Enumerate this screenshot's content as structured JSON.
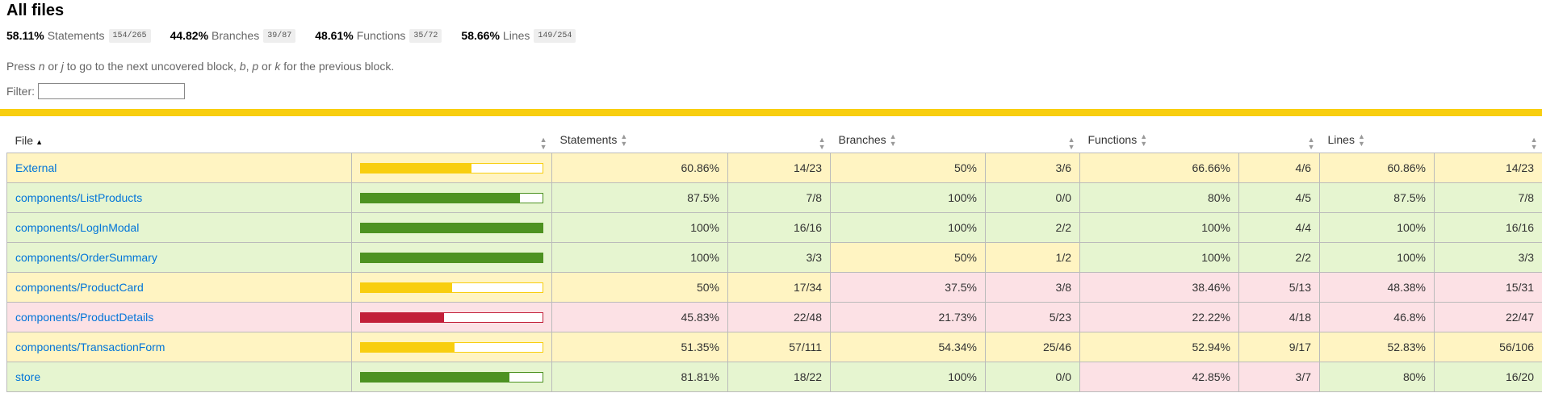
{
  "page": {
    "title": "All files"
  },
  "summary": [
    {
      "pct": "58.11%",
      "label": "Statements",
      "frac": "154/265"
    },
    {
      "pct": "44.82%",
      "label": "Branches",
      "frac": "39/87"
    },
    {
      "pct": "48.61%",
      "label": "Functions",
      "frac": "35/72"
    },
    {
      "pct": "58.66%",
      "label": "Lines",
      "frac": "149/254"
    }
  ],
  "hint": {
    "t1": "Press ",
    "k1": "n",
    "t2": " or ",
    "k2": "j",
    "t3": " to go to the next uncovered block, ",
    "k3": "b",
    "t4": ", ",
    "k4": "p",
    "t5": " or ",
    "k5": "k",
    "t6": " for the previous block."
  },
  "filter": {
    "label": "Filter:",
    "value": ""
  },
  "colors": {
    "high": "#4d9221",
    "medium": "#f8ce0f",
    "low": "#c21f39"
  },
  "table": {
    "headers": {
      "file": "File",
      "statements": "Statements",
      "branches": "Branches",
      "functions": "Functions",
      "lines": "Lines"
    },
    "rows": [
      {
        "file": "External",
        "level": "medium",
        "coverage": 60.86,
        "stmt": "60.86%",
        "stmt_frac": "14/23",
        "br": "50%",
        "br_frac": "3/6",
        "fn": "66.66%",
        "fn_frac": "4/6",
        "ln": "60.86%",
        "ln_frac": "14/23",
        "lv": [
          "medium",
          "medium",
          "medium",
          "medium"
        ]
      },
      {
        "file": "components/ListProducts",
        "level": "high",
        "coverage": 87.5,
        "stmt": "87.5%",
        "stmt_frac": "7/8",
        "br": "100%",
        "br_frac": "0/0",
        "fn": "80%",
        "fn_frac": "4/5",
        "ln": "87.5%",
        "ln_frac": "7/8",
        "lv": [
          "high",
          "high",
          "high",
          "high"
        ]
      },
      {
        "file": "components/LogInModal",
        "level": "high",
        "coverage": 100,
        "stmt": "100%",
        "stmt_frac": "16/16",
        "br": "100%",
        "br_frac": "2/2",
        "fn": "100%",
        "fn_frac": "4/4",
        "ln": "100%",
        "ln_frac": "16/16",
        "lv": [
          "high",
          "high",
          "high",
          "high"
        ]
      },
      {
        "file": "components/OrderSummary",
        "level": "high",
        "coverage": 100,
        "stmt": "100%",
        "stmt_frac": "3/3",
        "br": "50%",
        "br_frac": "1/2",
        "fn": "100%",
        "fn_frac": "2/2",
        "ln": "100%",
        "ln_frac": "3/3",
        "lv": [
          "high",
          "medium",
          "high",
          "high"
        ]
      },
      {
        "file": "components/ProductCard",
        "level": "medium",
        "coverage": 50,
        "stmt": "50%",
        "stmt_frac": "17/34",
        "br": "37.5%",
        "br_frac": "3/8",
        "fn": "38.46%",
        "fn_frac": "5/13",
        "ln": "48.38%",
        "ln_frac": "15/31",
        "lv": [
          "medium",
          "low",
          "low",
          "low"
        ]
      },
      {
        "file": "components/ProductDetails",
        "level": "low",
        "coverage": 45.83,
        "stmt": "45.83%",
        "stmt_frac": "22/48",
        "br": "21.73%",
        "br_frac": "5/23",
        "fn": "22.22%",
        "fn_frac": "4/18",
        "ln": "46.8%",
        "ln_frac": "22/47",
        "lv": [
          "low",
          "low",
          "low",
          "low"
        ]
      },
      {
        "file": "components/TransactionForm",
        "level": "medium",
        "coverage": 51.35,
        "stmt": "51.35%",
        "stmt_frac": "57/111",
        "br": "54.34%",
        "br_frac": "25/46",
        "fn": "52.94%",
        "fn_frac": "9/17",
        "ln": "52.83%",
        "ln_frac": "56/106",
        "lv": [
          "medium",
          "medium",
          "medium",
          "medium"
        ]
      },
      {
        "file": "store",
        "level": "high",
        "coverage": 81.81,
        "stmt": "81.81%",
        "stmt_frac": "18/22",
        "br": "100%",
        "br_frac": "0/0",
        "fn": "42.85%",
        "fn_frac": "3/7",
        "ln": "80%",
        "ln_frac": "16/20",
        "lv": [
          "high",
          "high",
          "low",
          "high"
        ]
      }
    ]
  }
}
